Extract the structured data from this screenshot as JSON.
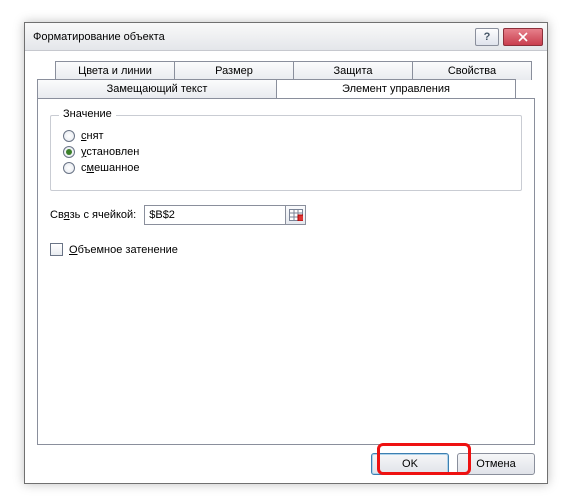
{
  "window": {
    "title": "Форматирование объекта"
  },
  "tabs": {
    "row1": [
      "Цвета и линии",
      "Размер",
      "Защита",
      "Свойства"
    ],
    "row2": [
      "Замещающий текст",
      "Элемент управления"
    ],
    "active": "Элемент управления"
  },
  "group": {
    "legend": "Значение",
    "radios": {
      "off": "снят",
      "on": "установлен",
      "mixed": "смешанное"
    },
    "selected": "on"
  },
  "cellLink": {
    "label": "Связь с ячейкой:",
    "value": "$B$2"
  },
  "shading": {
    "label": "Объемное затенение",
    "checked": false
  },
  "buttons": {
    "ok": "OK",
    "cancel": "Отмена"
  }
}
